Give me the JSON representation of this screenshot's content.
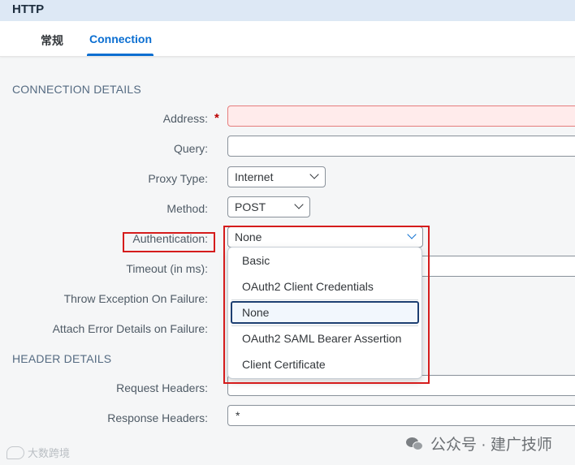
{
  "header": {
    "title": "HTTP"
  },
  "tabs": [
    {
      "label": "常规",
      "active": false
    },
    {
      "label": "Connection",
      "active": true
    }
  ],
  "sections": {
    "connection": "CONNECTION DETAILS",
    "header": "HEADER DETAILS"
  },
  "fields": {
    "address": {
      "label": "Address:",
      "required_mark": "*",
      "value": ""
    },
    "query": {
      "label": "Query:",
      "value": ""
    },
    "proxy_type": {
      "label": "Proxy Type:",
      "value": "Internet"
    },
    "method": {
      "label": "Method:",
      "value": "POST"
    },
    "authentication": {
      "label": "Authentication:",
      "value": "None",
      "options": [
        "Basic",
        "OAuth2 Client Credentials",
        "None",
        "OAuth2 SAML Bearer Assertion",
        "Client Certificate"
      ],
      "selected_option": "None"
    },
    "timeout": {
      "label": "Timeout (in ms):"
    },
    "throw_exception": {
      "label": "Throw Exception On Failure:"
    },
    "attach_error": {
      "label": "Attach Error Details on Failure:"
    },
    "request_headers": {
      "label": "Request Headers:",
      "value": ""
    },
    "response_headers": {
      "label": "Response Headers:",
      "value": "*"
    }
  },
  "watermark": {
    "right": "公众号 · 建广技师",
    "left": "大数跨境"
  },
  "colors": {
    "accent": "#0a6ed1",
    "error": "#bb0000",
    "annotation": "#d51c1c",
    "header_bg": "#dde8f5"
  }
}
